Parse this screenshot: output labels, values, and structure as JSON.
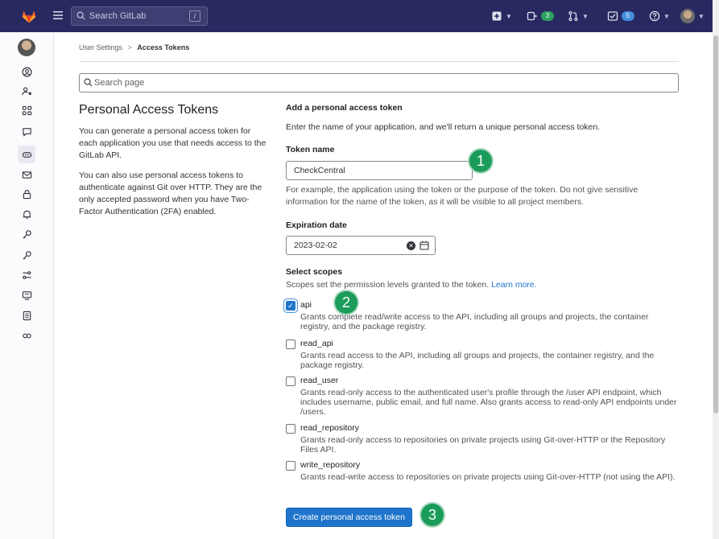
{
  "topbar": {
    "search_placeholder": "Search GitLab",
    "search_shortcut": "/",
    "issues_count": "3",
    "todos_count": "5"
  },
  "breadcrumb": {
    "parent": "User Settings",
    "separator": ">",
    "current": "Access Tokens"
  },
  "page_search_placeholder": "Search page",
  "intro": {
    "title": "Personal Access Tokens",
    "para1": "You can generate a personal access token for each application you use that needs access to the GitLab API.",
    "para2": "You can also use personal access tokens to authenticate against Git over HTTP. They are the only accepted password when you have Two-Factor Authentication (2FA) enabled."
  },
  "form": {
    "title": "Add a personal access token",
    "description": "Enter the name of your application, and we'll return a unique personal access token.",
    "token_name_label": "Token name",
    "token_name_value": "CheckCentral",
    "token_help": "For example, the application using the token or the purpose of the token. Do not give sensitive information for the name of the token, as it will be visible to all project members.",
    "expiration_label": "Expiration date",
    "expiration_value": "2023-02-02",
    "scopes_label": "Select scopes",
    "scopes_help": "Scopes set the permission levels granted to the token.",
    "learn_more": "Learn more.",
    "create_button": "Create personal access token"
  },
  "scopes": [
    {
      "name": "api",
      "checked": true,
      "description": "Grants complete read/write access to the API, including all groups and projects, the container registry, and the package registry."
    },
    {
      "name": "read_api",
      "checked": false,
      "description": "Grants read access to the API, including all groups and projects, the container registry, and the package registry."
    },
    {
      "name": "read_user",
      "checked": false,
      "description": "Grants read-only access to the authenticated user's profile through the /user API endpoint, which includes username, public email, and full name. Also grants access to read-only API endpoints under /users."
    },
    {
      "name": "read_repository",
      "checked": false,
      "description": "Grants read-only access to repositories on private projects using Git-over-HTTP or the Repository Files API."
    },
    {
      "name": "write_repository",
      "checked": false,
      "description": "Grants read-write access to repositories on private projects using Git-over-HTTP (not using the API)."
    }
  ],
  "markers": [
    "1",
    "2",
    "3"
  ],
  "colors": {
    "topbar": "#292961",
    "primary": "#1f75cb",
    "marker": "#1b9c5a"
  }
}
